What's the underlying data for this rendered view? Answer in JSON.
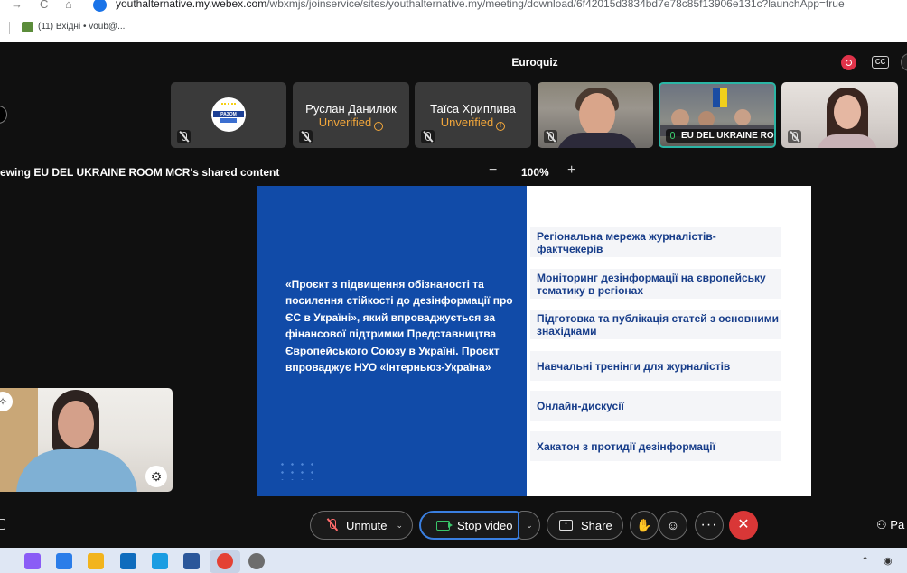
{
  "browser": {
    "nav_back": "→",
    "nav_reload": "C",
    "nav_home": "⌂",
    "url_host": "youthalternative.my.webex.com",
    "url_path": "/wbxmjs/joinservice/sites/youthalternative.my/meeting/download/6f42015d3834bd7e78c85f13906e131c?launchApp=true",
    "bookmark_label": "(11) Вхідні • voub@..."
  },
  "meeting": {
    "title": "Euroquiz",
    "cc_label": "CC",
    "record_icon": "record-icon"
  },
  "participants": [
    {
      "id": "logo",
      "logo_text": "РАЗОМ",
      "icon": "muted-mic-icon"
    },
    {
      "id": "ruslan",
      "name": "Руслан Данилюк",
      "status": "Unverified",
      "icon": "muted-mic-icon"
    },
    {
      "id": "taisa",
      "name": "Таїса Хрипливa",
      "status": "Unverified",
      "icon": "muted-mic-icon"
    },
    {
      "id": "video1",
      "icon": "muted-mic-icon"
    },
    {
      "id": "room",
      "name": "EU DEL UKRAINE ROOM",
      "icon": "mic-on-icon"
    },
    {
      "id": "video2",
      "icon": "muted-mic-icon"
    }
  ],
  "share": {
    "label": "ewing EU DEL UKRAINE ROOM MCR's shared content",
    "zoom_out": "−",
    "zoom_level": "100%",
    "zoom_in": "+"
  },
  "slide": {
    "quote": "«Проєкт з підвищення обізнаності та посилення стійкості до дезінформації про ЄС в Україні», який впроваджується за фінансової підтримки Представництва Європейського Союзу в Україні. Проєкт впроваджує НУО «Інтерньюз-Україна»",
    "items": [
      "Регіональна мережа журналістів-фактчекерів",
      "Моніторинг дезінформації на європейську тематику в регіонах",
      "Підготовка та публікація статей з основними знахідками",
      "Навчальні тренінги для журналістів",
      "Онлайн-дискусії",
      "Хакатон з протидії дезінформації"
    ]
  },
  "controls": {
    "unmute": "Unmute",
    "stop_video": "Stop video",
    "share": "Share",
    "more": "···",
    "leave": "✕",
    "participants_label": "Pa",
    "chevron": "⌄"
  },
  "taskbar": {
    "tray_up": "⌃",
    "colors": {
      "copilot": "#8a5cf6",
      "store": "#2b7de9",
      "explorer": "#f2b41d",
      "outlook": "#0f6cbd",
      "edge": "#1b9de2",
      "word": "#2b579a",
      "chrome": "#e44134",
      "settings": "#6d6d6d"
    }
  }
}
